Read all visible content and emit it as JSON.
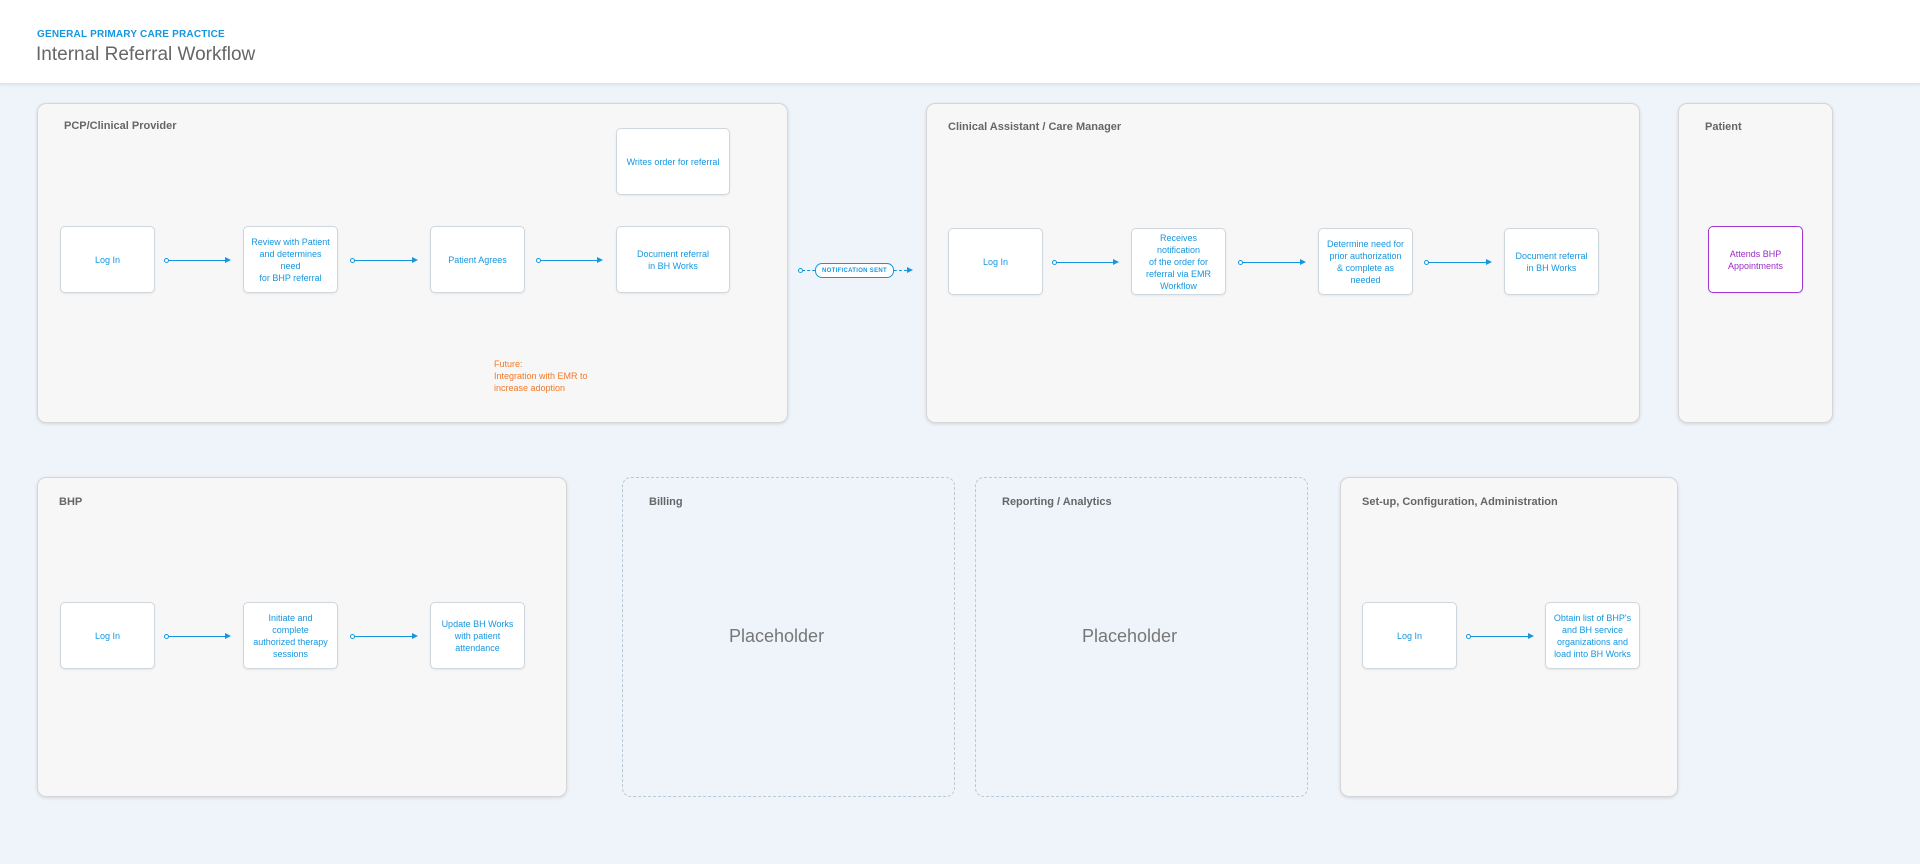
{
  "header": {
    "eyebrow": "GENERAL PRIMARY CARE PRACTICE",
    "title": "Internal Referral Workflow"
  },
  "panels": {
    "pcp": {
      "title": "PCP/Clinical Provider",
      "boxes": [
        "Log In",
        "Review with Patient\nand determines need\nfor BHP referral",
        "Patient Agrees",
        "Document referral\nin BH Works",
        "Writes order for referral"
      ],
      "note": "Future:\nIntegration with EMR to\nincrease adoption"
    },
    "clinical": {
      "title": "Clinical Assistant / Care Manager",
      "boxes": [
        "Log In",
        "Receives notification\nof the order for\nreferral via EMR\nWorkflow",
        "Determine need for\nprior authorization\n& complete as needed",
        "Document referral\nin BH Works"
      ]
    },
    "patient": {
      "title": "Patient",
      "boxes": [
        "Attends BHP\nAppointments"
      ]
    },
    "bhp": {
      "title": "BHP",
      "boxes": [
        "Log In",
        "Initiate and complete\nauthorized therapy\nsessions",
        "Update BH Works\nwith patient\nattendance"
      ]
    },
    "billing": {
      "title": "Billing",
      "placeholder": "Placeholder"
    },
    "reporting": {
      "title": "Reporting / Analytics",
      "placeholder": "Placeholder"
    },
    "setup": {
      "title": "Set-up, Configuration, Administration",
      "boxes": [
        "Log In",
        "Obtain list of BHP's\nand BH service\norganizations and\nload into BH Works"
      ]
    }
  },
  "connector": {
    "label": "NOTIFICATION SENT"
  },
  "colors": {
    "accent": "#1597e0",
    "future_note": "#f07a2a",
    "patient": "#a435cf",
    "background": "#eef4fa"
  }
}
